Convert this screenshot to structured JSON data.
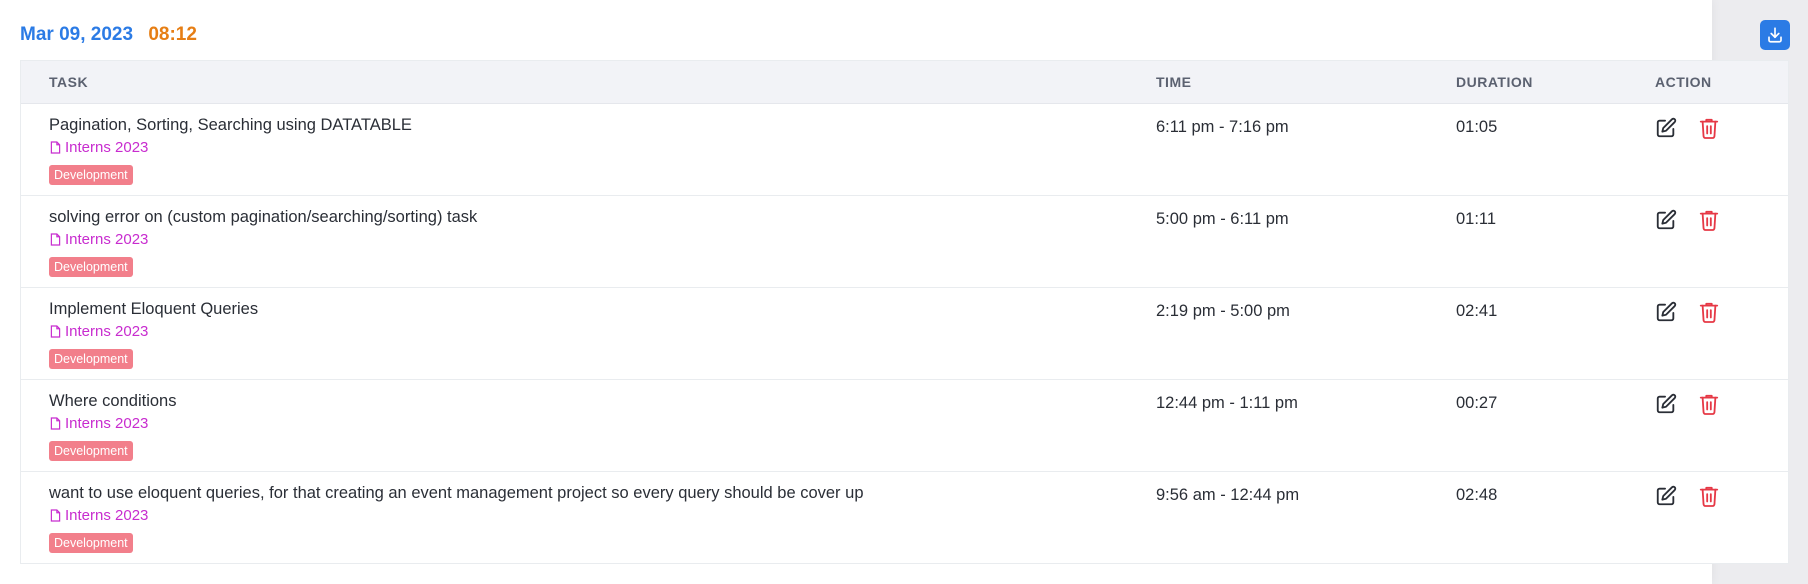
{
  "header": {
    "date": "Mar 09, 2023",
    "time": "08:12",
    "download_icon": "download-icon"
  },
  "colors": {
    "date": "#2b7be5",
    "time": "#e67e14",
    "project": "#c82ccf",
    "tag_bg": "#f27f8b",
    "delete": "#e63946",
    "button": "#2b7be5"
  },
  "table": {
    "columns": {
      "task": "TASK",
      "time": "TIME",
      "duration": "DURATION",
      "action": "ACTION"
    },
    "rows": [
      {
        "title": "Pagination, Sorting, Searching using DATATABLE",
        "project": "Interns 2023",
        "tag": "Development",
        "time": "6:11 pm - 7:16 pm",
        "duration": "01:05"
      },
      {
        "title": "solving error on (custom pagination/searching/sorting) task",
        "project": "Interns 2023",
        "tag": "Development",
        "time": "5:00 pm - 6:11 pm",
        "duration": "01:11"
      },
      {
        "title": "Implement Eloquent Queries",
        "project": "Interns 2023",
        "tag": "Development",
        "time": "2:19 pm - 5:00 pm",
        "duration": "02:41"
      },
      {
        "title": "Where conditions",
        "project": "Interns 2023",
        "tag": "Development",
        "time": "12:44 pm - 1:11 pm",
        "duration": "00:27"
      },
      {
        "title": "want to use eloquent queries, for that creating an event management project so every query should be cover up",
        "project": "Interns 2023",
        "tag": "Development",
        "time": "9:56 am - 12:44 pm",
        "duration": "02:48"
      }
    ]
  }
}
